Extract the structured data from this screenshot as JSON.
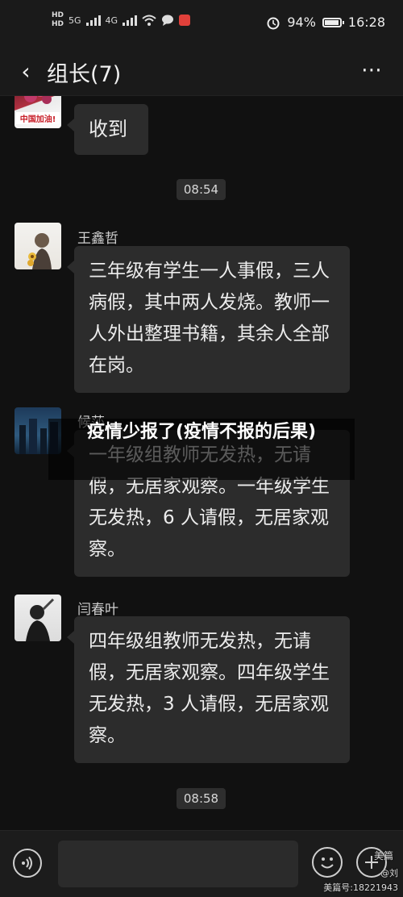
{
  "status_bar": {
    "hd1": "HD",
    "hd2": "HD",
    "net1": "5G",
    "net2": "4G",
    "battery_level": 0.94,
    "battery": "94%",
    "time": "16:28",
    "icons": [
      "hd-icon",
      "signal-icon",
      "wifi-icon",
      "chat-notification-icon",
      "app-notification-icon",
      "alarm-icon",
      "battery-icon"
    ]
  },
  "header": {
    "back_icon": "‹",
    "title": "组长(7)",
    "more_icon": "⋯"
  },
  "messages": [
    {
      "sender": "",
      "avatar_caption": "中国加油!",
      "text": "收到"
    },
    {
      "timestamp": "08:54"
    },
    {
      "sender": "王鑫哲",
      "text": "三年级有学生一人事假，三人病假，其中两人发烧。教师一人外出整理书籍，其余人全部在岗。"
    },
    {
      "sender": "候莎",
      "text": "一年级组教师无发热，无请假，无居家观察。一年级学生无发热，6 人请假，无居家观察。"
    },
    {
      "sender": "闫春叶",
      "text": "四年级组教师无发热，无请假，无居家观察。四年级学生无发热，3 人请假，无居家观察。"
    },
    {
      "timestamp": "08:58"
    }
  ],
  "overlay": {
    "headline": "疫情少报了(疫情不报的后果)"
  },
  "bottom_bar": {
    "voice_icon": "voice-icon",
    "emoji_icon": "emoji-icon",
    "plus_icon": "plus-icon"
  },
  "watermark": {
    "brand": "美篇",
    "author": "@刘",
    "id_text": "美篇号:18221943"
  },
  "colors": {
    "background": "#111111",
    "bubble": "#2c2c2c",
    "bar": "#1a1a1a"
  }
}
